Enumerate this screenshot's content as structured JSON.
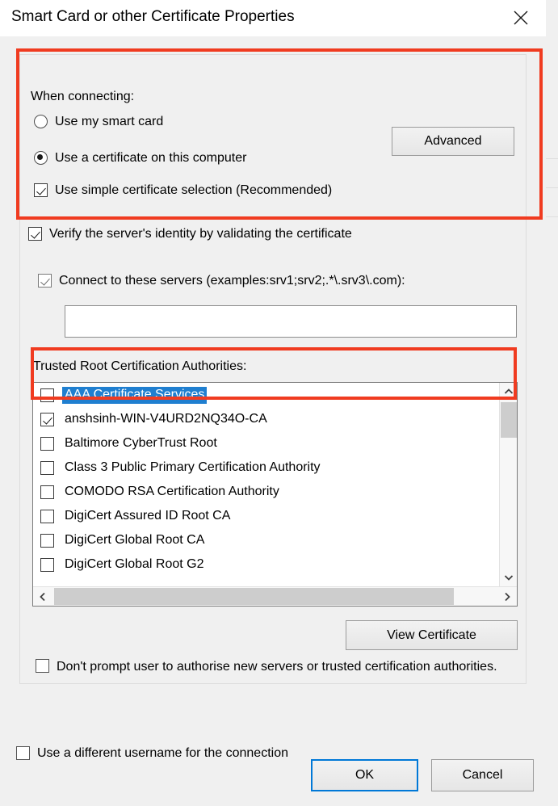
{
  "window": {
    "title": "Smart Card or other Certificate Properties",
    "close_icon": "close-icon"
  },
  "when_connecting": {
    "legend": "When connecting:",
    "options": [
      {
        "label": "Use my smart card",
        "checked": false
      },
      {
        "label": "Use a certificate on this computer",
        "checked": true
      }
    ],
    "simple_selection": {
      "label": "Use simple certificate selection (Recommended)",
      "checked": true
    },
    "advanced_button": "Advanced"
  },
  "verify": {
    "label": "Verify the server's identity by validating the certificate",
    "checked": true
  },
  "servers": {
    "label": "Connect to these servers (examples:srv1;srv2;.*\\.srv3\\.com):",
    "checked": true,
    "value": "",
    "placeholder": ""
  },
  "trusted_roots": {
    "label": "Trusted Root Certification Authorities:",
    "items": [
      {
        "label": "AAA Certificate Services",
        "checked": false,
        "selected": true
      },
      {
        "label": "anshsinh-WIN-V4URD2NQ34O-CA",
        "checked": true,
        "selected": false
      },
      {
        "label": "Baltimore CyberTrust Root",
        "checked": false,
        "selected": false
      },
      {
        "label": "Class 3 Public Primary Certification Authority",
        "checked": false,
        "selected": false
      },
      {
        "label": "COMODO RSA Certification Authority",
        "checked": false,
        "selected": false
      },
      {
        "label": "DigiCert Assured ID Root CA",
        "checked": false,
        "selected": false
      },
      {
        "label": "DigiCert Global Root CA",
        "checked": false,
        "selected": false
      },
      {
        "label": "DigiCert Global Root G2",
        "checked": false,
        "selected": false
      }
    ],
    "scroll_up_icon": "chevron-up-icon",
    "scroll_down_icon": "chevron-down-icon",
    "scroll_left_icon": "chevron-left-icon",
    "scroll_right_icon": "chevron-right-icon"
  },
  "view_certificate_button": "View Certificate",
  "dont_prompt": {
    "label": "Don't prompt user to authorise new servers or trusted certification authorities.",
    "checked": false
  },
  "different_username": {
    "label": "Use a different username for the connection",
    "checked": false
  },
  "footer": {
    "ok_label": "OK",
    "cancel_label": "Cancel"
  },
  "annotations": {
    "accent_color": "#f03b20",
    "selection_color": "#1f7fd0",
    "focus_color": "#0078d7"
  }
}
